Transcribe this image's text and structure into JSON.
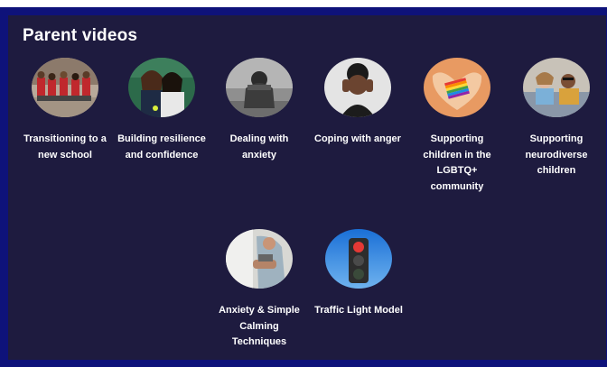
{
  "section": {
    "title": "Parent videos"
  },
  "videos": [
    {
      "label": "Transitioning to a new school",
      "icon": "school-children-thumbnail"
    },
    {
      "label": "Building resilience and confidence",
      "icon": "two-girls-thumbnail"
    },
    {
      "label": "Dealing with anxiety",
      "icon": "sad-child-thumbnail"
    },
    {
      "label": "Coping with anger",
      "icon": "covering-ears-thumbnail"
    },
    {
      "label": "Supporting children in the LGBTQ+ community",
      "icon": "rainbow-heart-thumbnail"
    },
    {
      "label": "Supporting neurodiverse children",
      "icon": "children-on-sofa-thumbnail"
    },
    {
      "label": "Anxiety & Simple Calming Techniques",
      "icon": "calm-person-thumbnail"
    },
    {
      "label": "Traffic Light Model",
      "icon": "traffic-light-thumbnail"
    }
  ],
  "colors": {
    "frame": "#0e127a",
    "panel": "#1e1b3f",
    "text": "#ffffff"
  }
}
